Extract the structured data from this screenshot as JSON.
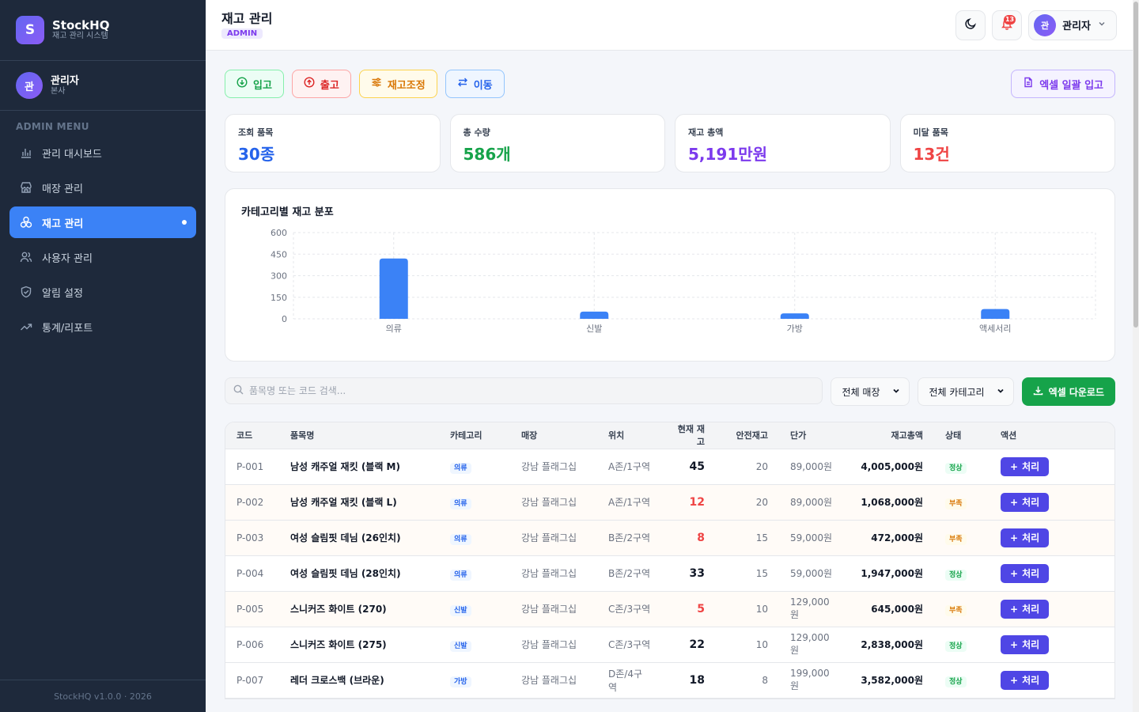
{
  "brand": {
    "logo_letter": "S",
    "name": "StockHQ",
    "subtitle": "재고 관리 시스템"
  },
  "sidebar_user": {
    "avatar": "관",
    "name": "관리자",
    "branch": "본사"
  },
  "menu": {
    "title": "ADMIN MENU",
    "items": [
      {
        "label": "관리 대시보드",
        "icon": "bar-chart-icon"
      },
      {
        "label": "매장 관리",
        "icon": "store-icon"
      },
      {
        "label": "재고 관리",
        "icon": "boxes-icon",
        "active": true
      },
      {
        "label": "사용자 관리",
        "icon": "users-icon"
      },
      {
        "label": "알림 설정",
        "icon": "shield-icon"
      },
      {
        "label": "통계/리포트",
        "icon": "trending-up-icon"
      }
    ],
    "footer": "StockHQ v1.0.0 · 2026"
  },
  "topbar": {
    "title": "재고 관리",
    "role": "ADMIN",
    "notif_count": "13",
    "user_avatar": "관",
    "user_name": "관리자"
  },
  "actions": {
    "in": "입고",
    "out": "출고",
    "adjust": "재고조정",
    "move": "이동",
    "excel_upload": "엑셀 일괄 입고"
  },
  "stats": [
    {
      "label": "조회 품목",
      "value": "30종",
      "color": "#2563eb"
    },
    {
      "label": "총 수량",
      "value": "586개",
      "color": "#16a34a"
    },
    {
      "label": "재고 총액",
      "value": "5,191만원",
      "color": "#7c3aed"
    },
    {
      "label": "미달 품목",
      "value": "13건",
      "color": "#ef4444"
    }
  ],
  "chart_data": {
    "type": "bar",
    "title": "카테고리별 재고 분포",
    "categories": [
      "의류",
      "신발",
      "가방",
      "액세서리"
    ],
    "values": [
      420,
      50,
      38,
      68
    ],
    "ylim": [
      0,
      600
    ],
    "yticks": [
      0,
      150,
      300,
      450,
      600
    ],
    "grid": true,
    "bar_color": "#3b82f6"
  },
  "filters": {
    "search_placeholder": "품목명 또는 코드 검색...",
    "store_select": "전체 매장",
    "category_select": "전체 카테고리",
    "excel_download": "엑셀 다운로드"
  },
  "table": {
    "headers": [
      "코드",
      "품목명",
      "카테고리",
      "매장",
      "위치",
      "현재 재고",
      "안전재고",
      "단가",
      "재고총액",
      "상태",
      "액션"
    ],
    "rows": [
      {
        "code": "P-001",
        "name": "남성 캐주얼 재킷 (블랙 M)",
        "category": "의류",
        "store": "강남 플래그십",
        "location": "A존/1구역",
        "stock": "45",
        "safety": "20",
        "price": "89,000원",
        "total": "4,005,000원",
        "status": "정상",
        "low": false
      },
      {
        "code": "P-002",
        "name": "남성 캐주얼 재킷 (블랙 L)",
        "category": "의류",
        "store": "강남 플래그십",
        "location": "A존/1구역",
        "stock": "12",
        "safety": "20",
        "price": "89,000원",
        "total": "1,068,000원",
        "status": "부족",
        "low": true
      },
      {
        "code": "P-003",
        "name": "여성 슬림핏 데님 (26인치)",
        "category": "의류",
        "store": "강남 플래그십",
        "location": "B존/2구역",
        "stock": "8",
        "safety": "15",
        "price": "59,000원",
        "total": "472,000원",
        "status": "부족",
        "low": true
      },
      {
        "code": "P-004",
        "name": "여성 슬림핏 데님 (28인치)",
        "category": "의류",
        "store": "강남 플래그십",
        "location": "B존/2구역",
        "stock": "33",
        "safety": "15",
        "price": "59,000원",
        "total": "1,947,000원",
        "status": "정상",
        "low": false
      },
      {
        "code": "P-005",
        "name": "스니커즈 화이트 (270)",
        "category": "신발",
        "store": "강남 플래그십",
        "location": "C존/3구역",
        "stock": "5",
        "safety": "10",
        "price": "129,000원",
        "total": "645,000원",
        "status": "부족",
        "low": true
      },
      {
        "code": "P-006",
        "name": "스니커즈 화이트 (275)",
        "category": "신발",
        "store": "강남 플래그십",
        "location": "C존/3구역",
        "stock": "22",
        "safety": "10",
        "price": "129,000원",
        "total": "2,838,000원",
        "status": "정상",
        "low": false
      },
      {
        "code": "P-007",
        "name": "레더 크로스백 (브라운)",
        "category": "가방",
        "store": "강남 플래그십",
        "location": "D존/4구역",
        "stock": "18",
        "safety": "8",
        "price": "199,000원",
        "total": "3,582,000원",
        "status": "정상",
        "low": false
      }
    ],
    "action_label": "처리"
  }
}
